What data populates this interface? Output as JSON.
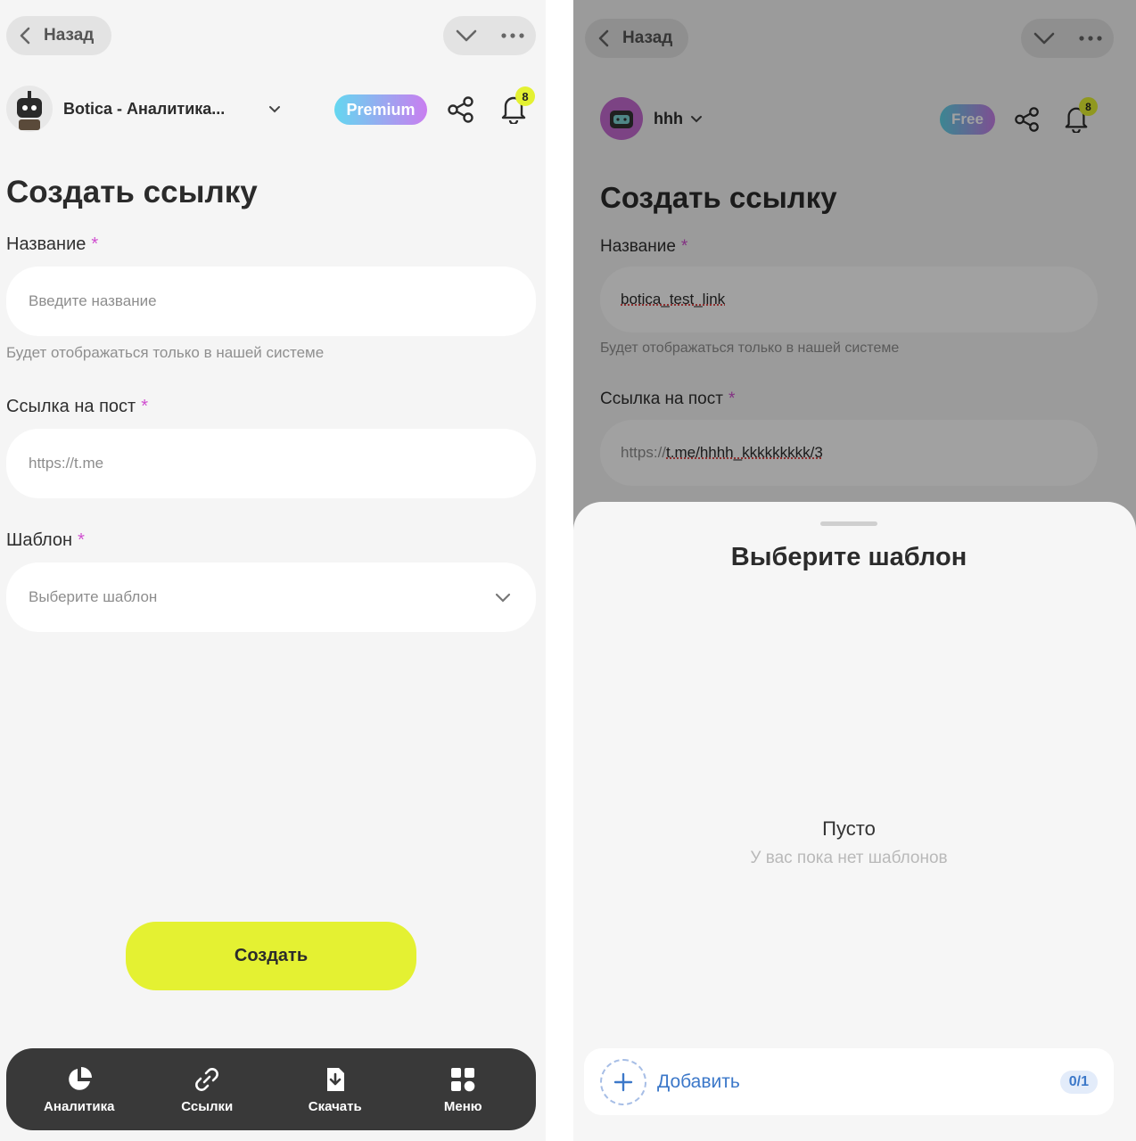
{
  "left": {
    "back_label": "Назад",
    "bot_name": "Botica - Аналитика...",
    "plan_badge": "Premium",
    "notifications_count": "8",
    "title": "Создать ссылку",
    "name_label": "Название",
    "name_placeholder": "Введите название",
    "name_hint": "Будет отображаться только в нашей системе",
    "post_label": "Ссылка на пост",
    "post_placeholder": "https://t.me",
    "template_label": "Шаблон",
    "template_placeholder": "Выберите шаблон",
    "required_mark": "*",
    "create_button": "Создать",
    "nav": [
      {
        "label": "Аналитика",
        "icon": "pie-chart-icon"
      },
      {
        "label": "Ссылки",
        "icon": "link-icon"
      },
      {
        "label": "Скачать",
        "icon": "download-file-icon"
      },
      {
        "label": "Меню",
        "icon": "grid-menu-icon"
      }
    ]
  },
  "right": {
    "back_label": "Назад",
    "bot_name": "hhh",
    "plan_badge": "Free",
    "notifications_count": "8",
    "title": "Создать ссылку",
    "name_label": "Название",
    "name_value": "botica_test_link",
    "name_hint": "Будет отображаться только в нашей системе",
    "post_label": "Ссылка на пост",
    "post_prefix": "https://",
    "post_value": "t.me/hhhh_kkkkkkkkk/3",
    "required_mark": "*",
    "sheet": {
      "title": "Выберите шаблон",
      "empty_title": "Пусто",
      "empty_subtitle": "У вас пока нет шаблонов",
      "add_label": "Добавить",
      "count": "0/1"
    }
  },
  "colors": {
    "accent_lime": "#e4f132",
    "required_pink": "#d04fd0",
    "link_blue": "#3c78c9",
    "nav_dark": "#393939"
  }
}
